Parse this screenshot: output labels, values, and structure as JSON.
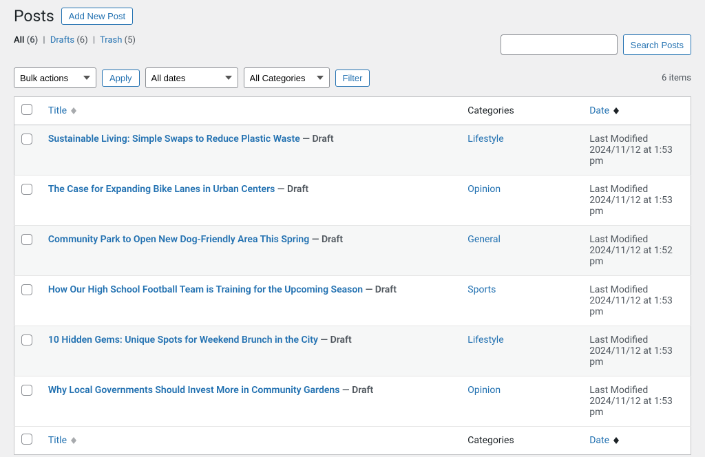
{
  "header": {
    "title": "Posts",
    "add_new_label": "Add New Post"
  },
  "filters": {
    "all_label": "All",
    "all_count": "(6)",
    "drafts_label": "Drafts",
    "drafts_count": "(6)",
    "trash_label": "Trash",
    "trash_count": "(5)"
  },
  "search": {
    "button_label": "Search Posts"
  },
  "tablenav": {
    "bulk_label": "Bulk actions",
    "apply_label": "Apply",
    "dates_label": "All dates",
    "categories_label": "All Categories",
    "filter_label": "Filter",
    "items_count": "6 items"
  },
  "columns": {
    "title": "Title",
    "categories": "Categories",
    "date": "Date"
  },
  "status_prefix": " — ",
  "posts": [
    {
      "title": "Sustainable Living: Simple Swaps to Reduce Plastic Waste",
      "state": "Draft",
      "category": "Lifestyle",
      "date_label": "Last Modified",
      "date_value": "2024/11/12 at 1:53 pm"
    },
    {
      "title": "The Case for Expanding Bike Lanes in Urban Centers",
      "state": "Draft",
      "category": "Opinion",
      "date_label": "Last Modified",
      "date_value": "2024/11/12 at 1:53 pm"
    },
    {
      "title": "Community Park to Open New Dog-Friendly Area This Spring",
      "state": "Draft",
      "category": "General",
      "date_label": "Last Modified",
      "date_value": "2024/11/12 at 1:52 pm"
    },
    {
      "title": "How Our High School Football Team is Training for the Upcoming Season",
      "state": "Draft",
      "category": "Sports",
      "date_label": "Last Modified",
      "date_value": "2024/11/12 at 1:53 pm"
    },
    {
      "title": "10 Hidden Gems: Unique Spots for Weekend Brunch in the City",
      "state": "Draft",
      "category": "Lifestyle",
      "date_label": "Last Modified",
      "date_value": "2024/11/12 at 1:53 pm"
    },
    {
      "title": "Why Local Governments Should Invest More in Community Gardens",
      "state": "Draft",
      "category": "Opinion",
      "date_label": "Last Modified",
      "date_value": "2024/11/12 at 1:53 pm"
    }
  ]
}
